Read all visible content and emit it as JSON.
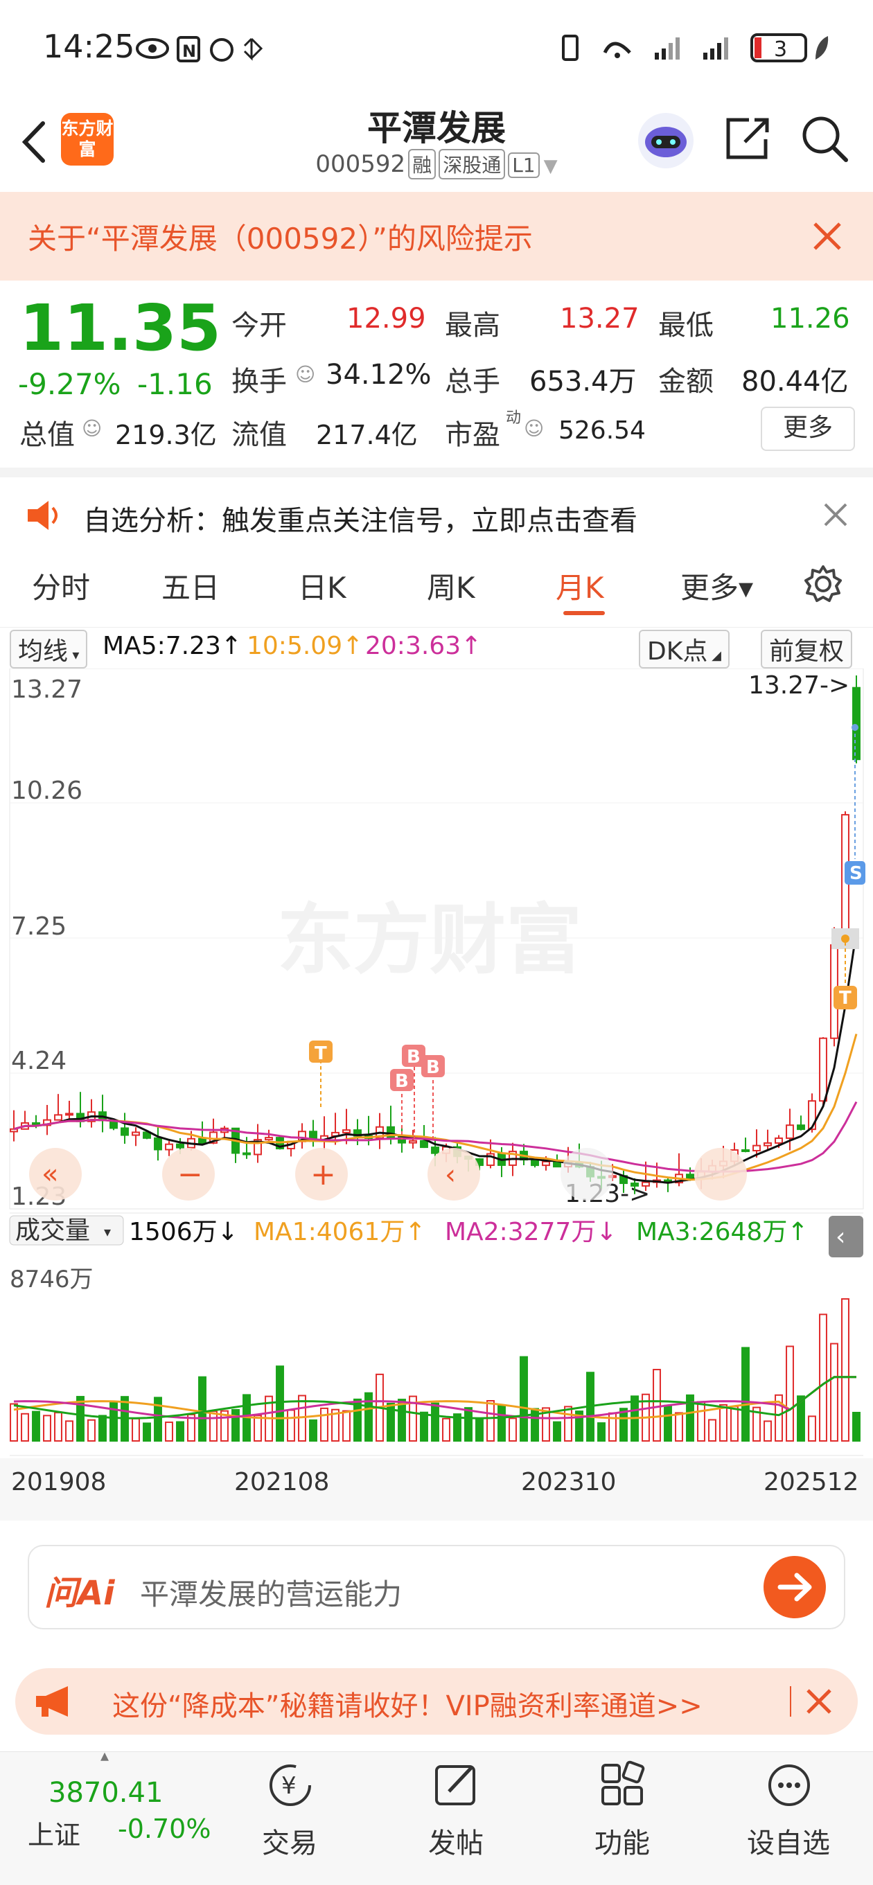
{
  "status_bar": {
    "time": "14:25",
    "battery": "3"
  },
  "header": {
    "logo": "东方财富",
    "title": "平潭发展",
    "code": "000592",
    "tags": [
      "融",
      "深股通",
      "L1"
    ]
  },
  "risk_banner": {
    "text": "关于“平潭发展（000592）”的风险提示"
  },
  "quote": {
    "price": "11.35",
    "change_pct": "-9.27%",
    "change": "-1.16",
    "fields": [
      {
        "label": "今开",
        "value": "12.99",
        "color": "#e02b2b"
      },
      {
        "label": "最高",
        "value": "13.27",
        "color": "#e02b2b"
      },
      {
        "label": "最低",
        "value": "11.26",
        "color": "#1aa31a"
      },
      {
        "label": "换手",
        "value": "34.12%",
        "color": "#222"
      },
      {
        "label": "总手",
        "value": "653.4万",
        "color": "#222"
      },
      {
        "label": "金额",
        "value": "80.44亿",
        "color": "#222"
      },
      {
        "label": "总值",
        "value": "219.3亿",
        "color": "#222"
      },
      {
        "label": "流值",
        "value": "217.4亿",
        "color": "#222"
      },
      {
        "label": "市盈",
        "value": "526.54",
        "color": "#222"
      }
    ],
    "pe_sup": "动",
    "more": "更多"
  },
  "analysis": {
    "text": "自选分析：触发重点关注信号，立即点击查看"
  },
  "tabs": [
    "分时",
    "五日",
    "日K",
    "周K",
    "月K",
    "更多▾"
  ],
  "active_tab": "月K",
  "ma_bar": {
    "select": "均线",
    "ma5": "MA5:7.23↑",
    "ma10": "10:5.09↑",
    "ma20": "20:3.63↑",
    "dk": "DK点",
    "fq": "前复权"
  },
  "price_chart": {
    "y_labels": [
      "13.27",
      "10.26",
      "7.25",
      "4.24",
      "1.23"
    ],
    "max_marker": "13.27->",
    "min_marker": "1.23->",
    "watermark": "东方财富",
    "signals": [
      "T",
      "B",
      "B",
      "B",
      "S",
      "T"
    ]
  },
  "volume_bar": {
    "select": "成交量",
    "current": "1506万↓",
    "ma1": "MA1:4061万↑",
    "ma2": "MA2:3277万↓",
    "ma3": "MA3:2648万↑",
    "max_label": "8746万"
  },
  "x_labels": [
    "201908",
    "202108",
    "202310",
    "202512"
  ],
  "ask_ai": {
    "brand": "问Ai",
    "placeholder": "平潭发展的营运能力"
  },
  "promo": {
    "text": "这份“降成本”秘籍请收好！VIP融资利率通道>>"
  },
  "bottom_nav": {
    "index_value": "3870.41",
    "index_name": "上证",
    "index_change": "-0.70%",
    "items": [
      "交易",
      "发帖",
      "功能",
      "设自选"
    ]
  },
  "colors": {
    "up": "#e02b2b",
    "down": "#1aa31a",
    "accent": "#e8542a",
    "ma5": "#111111",
    "ma10": "#f0a020",
    "ma20": "#cc2f9a"
  },
  "chart_data": {
    "type": "candlestick",
    "price_range": [
      1.23,
      13.27
    ],
    "volume_max_wan": 8746,
    "months": 77,
    "x_ticks": [
      "201908",
      "202108",
      "202310",
      "202512"
    ],
    "last": {
      "open": 12.99,
      "high": 13.27,
      "low": 11.26,
      "close": 11.35,
      "ma5": 7.23,
      "ma10": 5.09,
      "ma20": 3.63
    }
  }
}
